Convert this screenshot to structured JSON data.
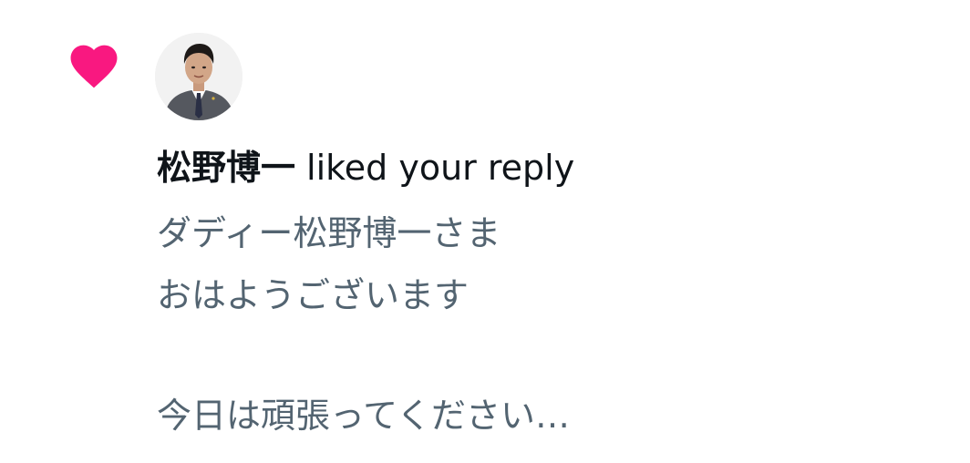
{
  "notification": {
    "icons": {
      "like": "heart-icon",
      "avatar": "user-avatar"
    },
    "colors": {
      "heart": "#f91880",
      "name": "#0f1419",
      "reply_text": "#536471"
    },
    "user_name": "松野博一",
    "action_text": "liked your reply",
    "reply_lines": [
      "ダディー松野博一さま",
      "おはようございます",
      "今日は頑張ってください…"
    ]
  }
}
